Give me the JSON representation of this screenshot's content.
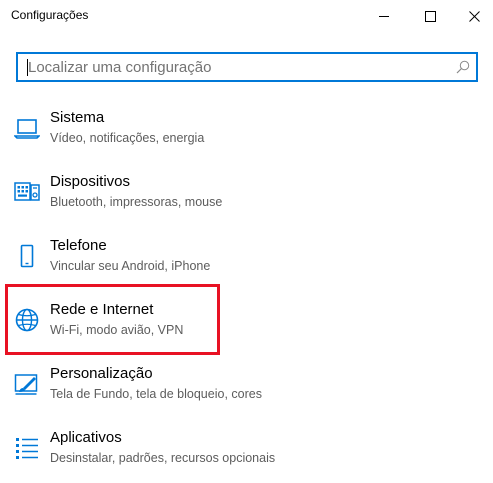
{
  "window": {
    "title": "Configurações"
  },
  "search": {
    "placeholder": "Localizar uma configuração",
    "value": ""
  },
  "categories": [
    {
      "title": "Sistema",
      "desc": "Vídeo, notificações, energia",
      "icon": "laptop-icon"
    },
    {
      "title": "Dispositivos",
      "desc": "Bluetooth, impressoras, mouse",
      "icon": "devices-icon"
    },
    {
      "title": "Telefone",
      "desc": "Vincular seu Android, iPhone",
      "icon": "phone-icon"
    },
    {
      "title": "Rede e Internet",
      "desc": "Wi-Fi, modo avião, VPN",
      "icon": "globe-icon"
    },
    {
      "title": "Personalização",
      "desc": "Tela de Fundo, tela de bloqueio, cores",
      "icon": "brush-icon"
    },
    {
      "title": "Aplicativos",
      "desc": "Desinstalar, padrões, recursos opcionais",
      "icon": "apps-list-icon"
    }
  ],
  "colors": {
    "accent": "#0078d7",
    "highlight": "#e81123",
    "secondary_text": "#5c5c5c"
  }
}
